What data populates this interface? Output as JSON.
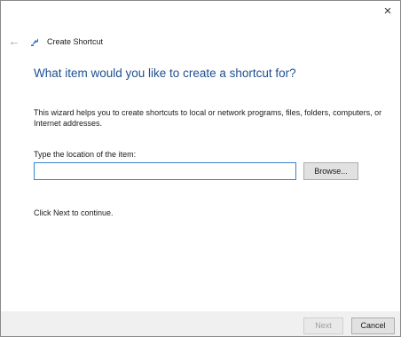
{
  "window": {
    "close_glyph": "×"
  },
  "nav": {
    "back_glyph": "←",
    "title": "Create Shortcut"
  },
  "main": {
    "heading": "What item would you like to create a shortcut for?",
    "description": "This wizard helps you to create shortcuts to local or network programs, files, folders, computers, or Internet addresses.",
    "location_label": "Type the location of the item:",
    "location_value": "",
    "browse_label": "Browse...",
    "hint": "Click Next to continue."
  },
  "footer": {
    "next_label": "Next",
    "cancel_label": "Cancel"
  },
  "colors": {
    "heading": "#1e4f8f",
    "input_border": "#3c84cc",
    "footer_bg": "#f0f0f0"
  }
}
